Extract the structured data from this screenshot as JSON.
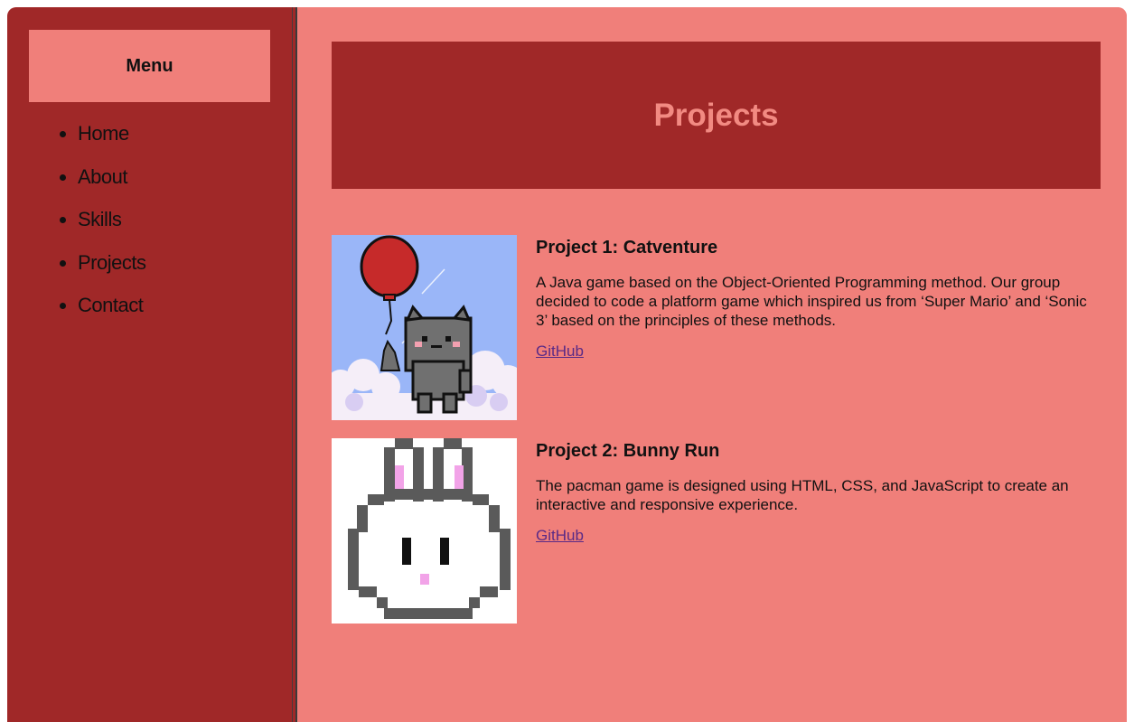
{
  "sidebar": {
    "menu_title": "Menu",
    "items": [
      {
        "label": "Home"
      },
      {
        "label": "About"
      },
      {
        "label": "Skills"
      },
      {
        "label": "Projects"
      },
      {
        "label": "Contact"
      }
    ]
  },
  "main": {
    "banner_title": "Projects",
    "projects": [
      {
        "title": "Project 1: Catventure",
        "description": "A Java game based on the Object-Oriented Programming method. Our group decided to code a platform game which inspired us from ‘Super Mario’ and ‘Sonic 3’ based on the principles of these methods.",
        "link_label": "GitHub",
        "image": "pixel-cat-with-balloon"
      },
      {
        "title": "Project 2: Bunny Run",
        "description": "The pacman game is designed using HTML, CSS, and JavaScript to create an interactive and responsive experience.",
        "link_label": "GitHub",
        "image": "pixel-bunny-face"
      }
    ]
  },
  "colors": {
    "dark_red": "#a02828",
    "salmon": "#f07f7a",
    "banner_text": "#f28a82",
    "link": "#5a2a86"
  }
}
